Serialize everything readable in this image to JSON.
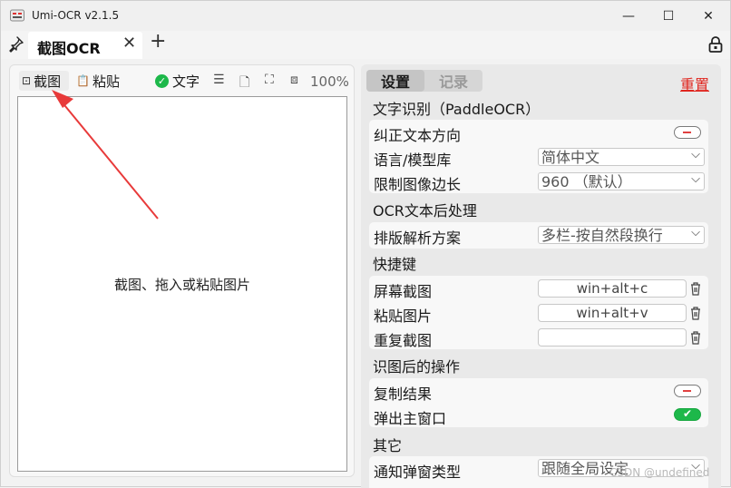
{
  "window": {
    "title": "Umi-OCR v2.1.5",
    "minimize": "—",
    "maximize": "☐",
    "close": "✕"
  },
  "tabbar": {
    "pin": "📌",
    "tab_label": "截图OCR",
    "tab_close": "✕",
    "add": "+"
  },
  "left": {
    "screenshot_btn": "截图",
    "paste_btn": "粘贴",
    "text_toggle": "文字",
    "zoom": "100%",
    "hint": "截图、拖入或粘贴图片"
  },
  "right": {
    "tabs": [
      "设置",
      "记录"
    ],
    "reset": "重置",
    "sections": {
      "ocr": {
        "title": "文字识别（PaddleOCR）",
        "correct_direction": "纠正文本方向",
        "language_label": "语言/模型库",
        "language_value": "简体中文",
        "limit_label": "限制图像边长",
        "limit_value": "960 （默认）"
      },
      "post": {
        "title": "OCR文本后处理",
        "layout_label": "排版解析方案",
        "layout_value": "多栏-按自然段换行"
      },
      "hotkeys": {
        "title": "快捷键",
        "screen_label": "屏幕截图",
        "screen_value": "win+alt+c",
        "paste_label": "粘贴图片",
        "paste_value": "win+alt+v",
        "repeat_label": "重复截图",
        "repeat_value": ""
      },
      "after": {
        "title": "识图后的操作",
        "copy_label": "复制结果",
        "popup_label": "弹出主窗口"
      },
      "other": {
        "title": "其它",
        "notify_label": "通知弹窗类型",
        "notify_value": "跟随全局设定"
      }
    },
    "toggles": {
      "correct_direction": false,
      "copy_result": false,
      "popup_main": true
    }
  },
  "watermark": "CSDN @undefined",
  "colors": {
    "accent_red": "#e0261f",
    "toggle_green": "#1db84a",
    "arrow_red": "#e83a3a"
  }
}
